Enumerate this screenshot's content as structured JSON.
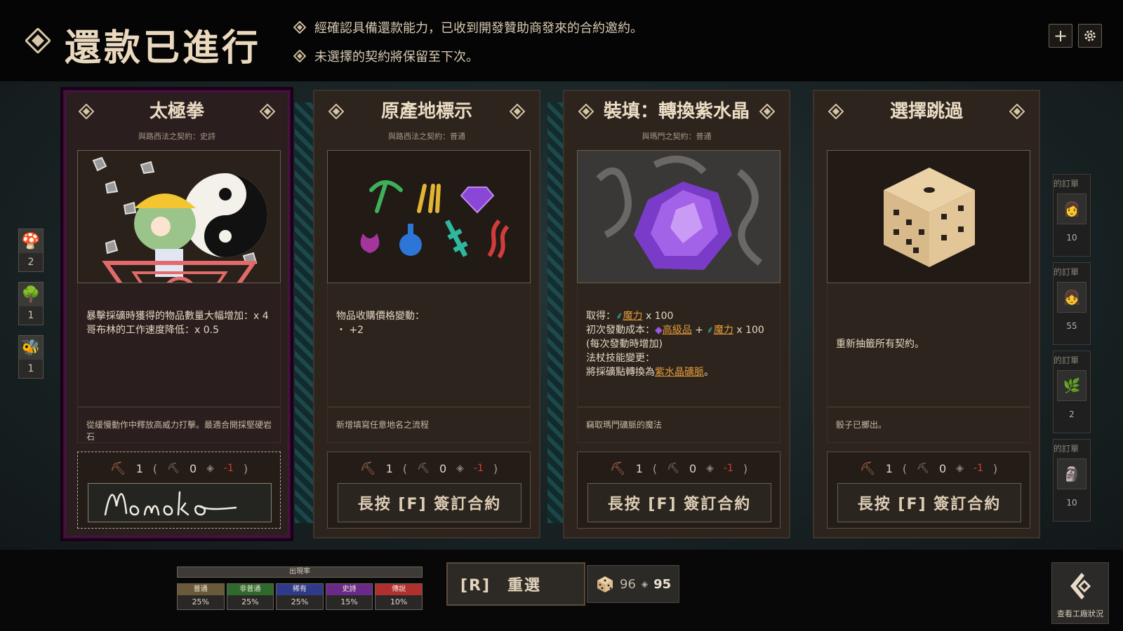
{
  "header": {
    "title": "還款已進行",
    "notices": [
      "經確認具備還款能力，已收到開發贊助商發來的合約邀約。",
      "未選擇的契約將保留至下次。"
    ]
  },
  "left_sidebar": [
    {
      "icon": "mushroom-icon",
      "count": "2"
    },
    {
      "icon": "tree-icon",
      "count": "1"
    },
    {
      "icon": "beehive-icon",
      "count": "1"
    }
  ],
  "right_sidebar": [
    {
      "label": "的訂單",
      "icon": "character-portrait-icon",
      "count": "10"
    },
    {
      "label": "的訂單",
      "icon": "character-portrait-icon",
      "count": "55"
    },
    {
      "label": "的訂單",
      "icon": "leaf-item-icon",
      "count": "2"
    },
    {
      "label": "的訂單",
      "icon": "figure-item-icon",
      "count": "10"
    }
  ],
  "cards": [
    {
      "title": "太極拳",
      "subtitle": "與路西法之契約：史詩",
      "art": "taiji-miner-art",
      "lines": [
        "暴擊採礦時獲得的物品數量大幅增加：x 4",
        "哥布林的工作速度降低：x 0.5"
      ],
      "flavor": "從緩慢動作中釋放高威力打擊。最適合開採堅硬岩石",
      "cost": {
        "pick": "1",
        "a": "0",
        "b": "-1"
      },
      "action": "Momoko",
      "selected": true
    },
    {
      "title": "原產地標示",
      "subtitle": "與路西法之契約：普通",
      "art": "resource-icons-art",
      "lines": [
        "物品收購價格變動：",
        "・ +2"
      ],
      "flavor": "新增填寫任意地名之流程",
      "cost": {
        "pick": "1",
        "a": "0",
        "b": "-1"
      },
      "action": "長按 [F] 簽訂合約",
      "selected": false
    },
    {
      "title": "裝填：轉換紫水晶",
      "subtitle": "與瑪門之契約：普通",
      "art": "amethyst-art",
      "lines_rich": {
        "l1a": "取得：",
        "l1b": "魔力",
        "l1c": " x 100",
        "l2a": "初次發動成本：",
        "l2b": "高級品",
        "l2c": " + ",
        "l2d": "魔力",
        "l2e": " x 100",
        "l3": "(每次發動時增加)",
        "l4": "法杖技能變更：",
        "l5a": "將採礦點轉換為",
        "l5b": "紫水晶礦脈",
        "l5c": "。"
      },
      "flavor": "竊取瑪門礦脈的魔法",
      "cost": {
        "pick": "1",
        "a": "0",
        "b": "-1"
      },
      "action": "長按 [F] 簽訂合約",
      "selected": false
    },
    {
      "title": "選擇跳過",
      "subtitle": "",
      "art": "dice-art",
      "lines": [
        "重新抽籤所有契約。"
      ],
      "flavor": "骰子已擲出。",
      "cost": {
        "pick": "1",
        "a": "0",
        "b": "-1"
      },
      "action": "長按 [F] 簽訂合約",
      "selected": false
    }
  ],
  "rates": {
    "title": "出現率",
    "items": [
      {
        "name": "普通",
        "pct": "25%",
        "color": "#6b5a3a"
      },
      {
        "name": "非普通",
        "pct": "25%",
        "color": "#2f6a2c"
      },
      {
        "name": "稀有",
        "pct": "25%",
        "color": "#2f3a8a"
      },
      {
        "name": "史詩",
        "pct": "15%",
        "color": "#6a2a8a"
      },
      {
        "name": "傳說",
        "pct": "10%",
        "color": "#b02f2f"
      }
    ]
  },
  "reroll": {
    "label": "[R]　重選"
  },
  "dice": {
    "from": "96",
    "to": "95"
  },
  "factory_button": {
    "label": "查看工廠狀況"
  },
  "colors": {
    "accent_orange": "#e39a3a",
    "mana_teal": "#2fb7a0",
    "gem_purple": "#9b57e0",
    "negative": "#d33c3c"
  }
}
